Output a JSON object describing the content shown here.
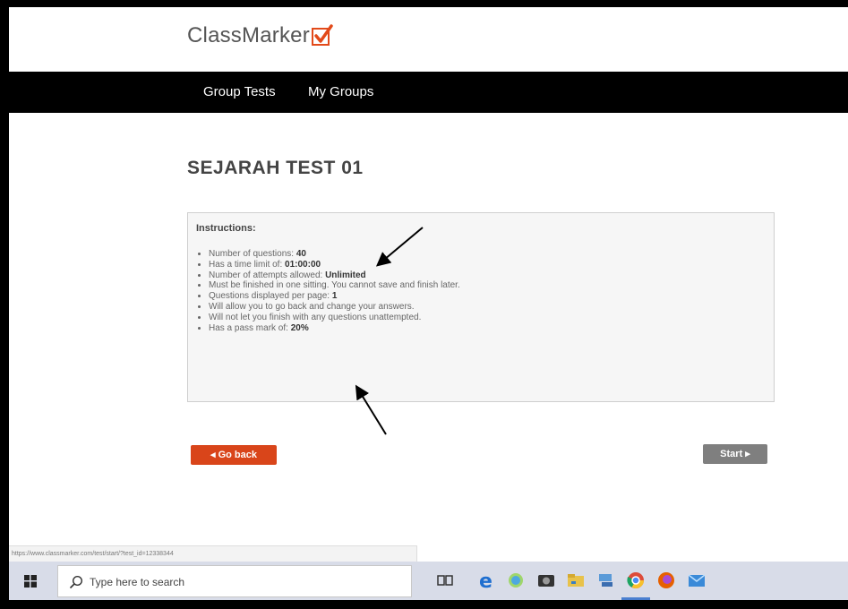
{
  "app": {
    "logo_text": "ClassMarker",
    "brand_color": "#e24a1a"
  },
  "nav": {
    "items": [
      {
        "label": "Group Tests"
      },
      {
        "label": "My Groups"
      }
    ]
  },
  "test": {
    "title": "SEJARAH TEST 01",
    "instructions_heading": "Instructions:",
    "instructions": [
      {
        "text": "Number of questions: ",
        "value": "40"
      },
      {
        "text": "Has a time limit of: ",
        "value": "01:00:00"
      },
      {
        "text": "Number of attempts allowed: ",
        "value": "Unlimited"
      },
      {
        "text": "Must be finished in one sitting. You cannot save and finish later.",
        "value": ""
      },
      {
        "text": "Questions displayed per page: ",
        "value": "1"
      },
      {
        "text": "Will allow you to go back and change your answers.",
        "value": ""
      },
      {
        "text": "Will not let you finish with any questions unattempted.",
        "value": ""
      },
      {
        "text": "Has a pass mark of: ",
        "value": "20%"
      }
    ]
  },
  "buttons": {
    "back_label": "◂ Go back",
    "start_label": "Start ▸",
    "back_color": "#d9451a",
    "start_color": "#7f7f7f"
  },
  "statusbar": {
    "url": "https://www.classmarker.com/test/start/?test_id=12338344"
  },
  "taskbar": {
    "search_placeholder": "Type here to search",
    "icons": [
      "windows-start-icon",
      "task-view-icon",
      "edge-icon",
      "cortana-icon",
      "camera-icon",
      "file-explorer-icon",
      "network-icon",
      "chrome-icon",
      "firefox-icon",
      "mail-icon"
    ]
  }
}
